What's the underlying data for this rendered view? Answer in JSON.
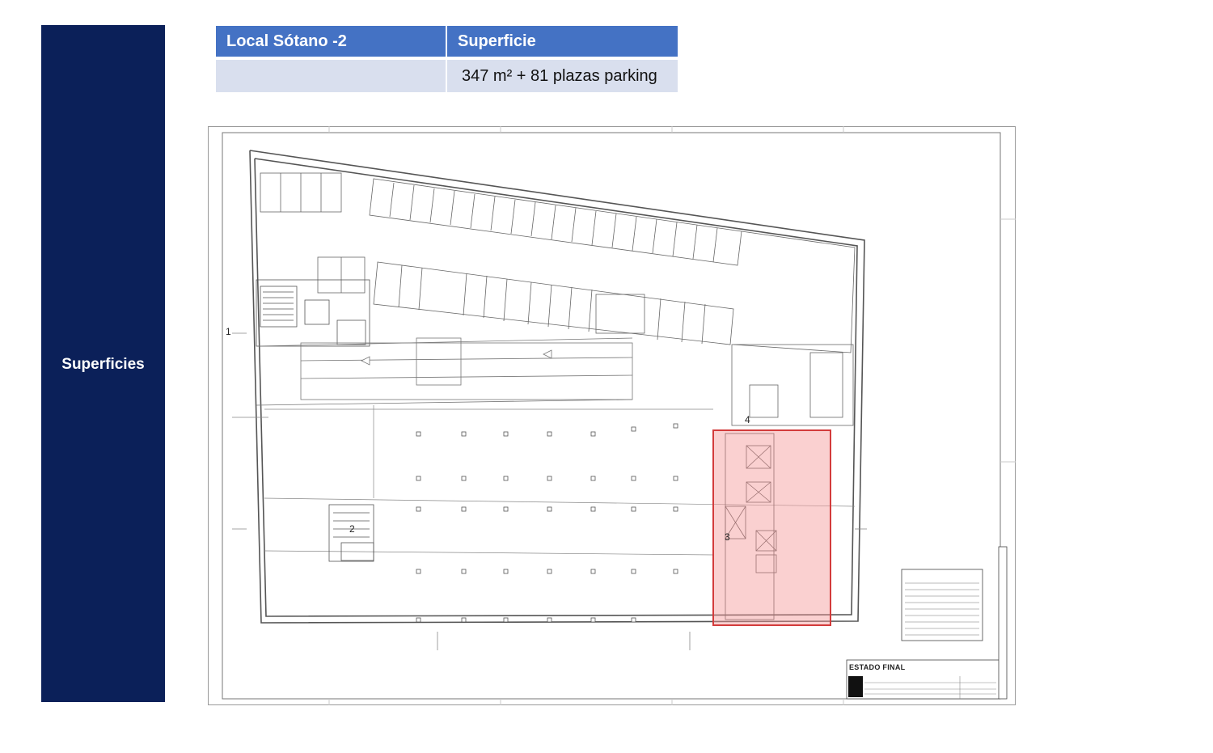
{
  "sidebar": {
    "title": "Superficies"
  },
  "table": {
    "headers": [
      "Local Sótano -2",
      "Superficie"
    ],
    "row": [
      "",
      "347 m² + 81 plazas parking"
    ]
  },
  "plan": {
    "stamp_title": "ESTADO FINAL",
    "markers": [
      "1",
      "2",
      "3",
      "4"
    ],
    "highlight_color": "#f59696",
    "highlight_border": "#d33b3b"
  }
}
